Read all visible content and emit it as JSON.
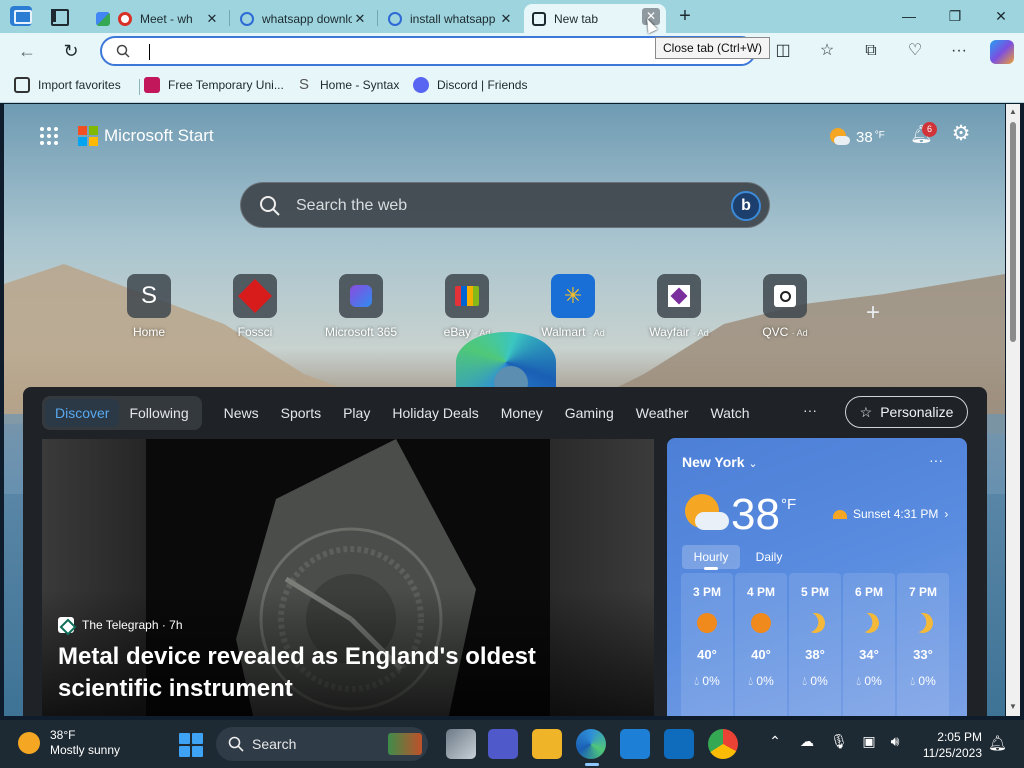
{
  "tabs": [
    {
      "label": "Meet - wh",
      "close": "✕"
    },
    {
      "label": "whatsapp download",
      "close": "✕"
    },
    {
      "label": "install whatsapp",
      "close": "✕"
    },
    {
      "label": "New tab",
      "close": "✕"
    }
  ],
  "tooltip": "Close tab (Ctrl+W)",
  "address": {
    "value": "",
    "placeholder": ""
  },
  "favorites": [
    {
      "label": "Import favorites"
    },
    {
      "label": "Free Temporary Uni..."
    },
    {
      "label": "Home - Syntax"
    },
    {
      "label": "Discord | Friends"
    }
  ],
  "header": {
    "title": "Microsoft Start",
    "weather_temp": "38",
    "weather_unit": "°F",
    "notification_count": "6"
  },
  "search": {
    "placeholder": "Search the web",
    "bing_letter": "b"
  },
  "tiles": [
    {
      "label": "Home",
      "ad": ""
    },
    {
      "label": "Fossci",
      "ad": ""
    },
    {
      "label": "Microsoft 365",
      "ad": ""
    },
    {
      "label": "eBay",
      "ad": "· Ad"
    },
    {
      "label": "Walmart",
      "ad": "· Ad"
    },
    {
      "label": "Wayfair",
      "ad": "· Ad"
    },
    {
      "label": "QVC",
      "ad": "· Ad"
    }
  ],
  "tile_home_letter": "S",
  "feed": {
    "pills": [
      "Discover",
      "Following"
    ],
    "links": [
      "News",
      "Sports",
      "Play",
      "Holiday Deals",
      "Money",
      "Gaming",
      "Weather",
      "Watch"
    ],
    "more": "···",
    "personalize": "Personalize"
  },
  "article": {
    "source": "The Telegraph · 7h",
    "headline": "Metal device revealed as England's oldest scientific instrument"
  },
  "weather_card": {
    "city": "New York",
    "temp": "38",
    "unit": "°F",
    "sunset": "Sunset 4:31 PM",
    "tabs": [
      "Hourly",
      "Daily"
    ],
    "hours": [
      {
        "time": "3 PM",
        "icon": "sun",
        "temp": "40°",
        "precip": "0%"
      },
      {
        "time": "4 PM",
        "icon": "sun",
        "temp": "40°",
        "precip": "0%"
      },
      {
        "time": "5 PM",
        "icon": "moon",
        "temp": "38°",
        "precip": "0%"
      },
      {
        "time": "6 PM",
        "icon": "moon",
        "temp": "34°",
        "precip": "0%"
      },
      {
        "time": "7 PM",
        "icon": "moon",
        "temp": "33°",
        "precip": "0%"
      }
    ]
  },
  "taskbar": {
    "weather_temp": "38°F",
    "weather_desc": "Mostly sunny",
    "search_label": "Search",
    "time": "2:05 PM",
    "date": "11/25/2023"
  }
}
